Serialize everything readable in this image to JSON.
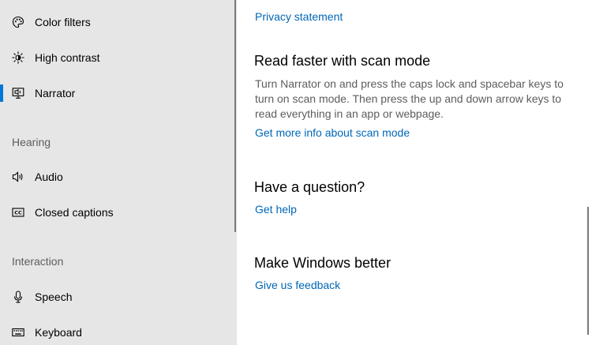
{
  "sidebar": {
    "items_top": [
      {
        "label": "Color filters",
        "icon": "color-filters-icon"
      },
      {
        "label": "High contrast",
        "icon": "high-contrast-icon"
      },
      {
        "label": "Narrator",
        "icon": "narrator-icon",
        "selected": true
      }
    ],
    "hearing": {
      "header": "Hearing",
      "items": [
        {
          "label": "Audio",
          "icon": "speaker-icon"
        },
        {
          "label": "Closed captions",
          "icon": "closed-captions-icon"
        }
      ]
    },
    "interaction": {
      "header": "Interaction",
      "items": [
        {
          "label": "Speech",
          "icon": "microphone-icon"
        },
        {
          "label": "Keyboard",
          "icon": "keyboard-icon"
        }
      ]
    }
  },
  "main": {
    "privacy_link": "Privacy statement",
    "scan_mode": {
      "heading": "Read faster with scan mode",
      "body": "Turn Narrator on and press the caps lock and spacebar keys to turn on scan mode. Then press the up and down arrow keys to read everything in an app or webpage.",
      "link": "Get more info about scan mode"
    },
    "question": {
      "heading": "Have a question?",
      "link": "Get help"
    },
    "feedback": {
      "heading": "Make Windows better",
      "link": "Give us feedback"
    }
  },
  "colors": {
    "accent": "#0078d7",
    "link": "#0067b8",
    "sidebar_bg": "#e6e6e6",
    "secondary_text": "#5d5d5d"
  }
}
